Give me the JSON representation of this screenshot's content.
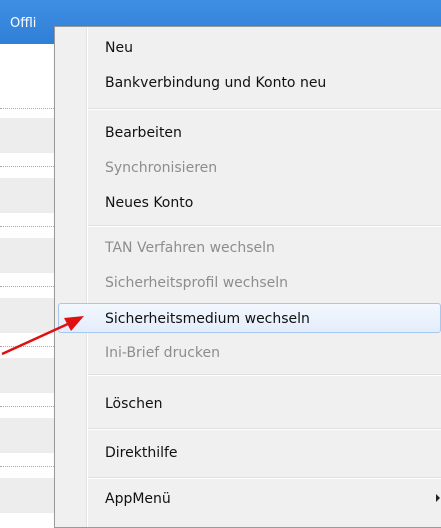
{
  "app": {
    "header_label": "Offli"
  },
  "context_menu": {
    "items": [
      {
        "label": "Neu",
        "enabled": true
      },
      {
        "label": "Bankverbindung und Konto neu",
        "enabled": true
      },
      {
        "label": "Bearbeiten",
        "enabled": true
      },
      {
        "label": "Synchronisieren",
        "enabled": false
      },
      {
        "label": "Neues Konto",
        "enabled": true
      },
      {
        "label": "TAN Verfahren wechseln",
        "enabled": false
      },
      {
        "label": "Sicherheitsprofil wechseln",
        "enabled": false
      },
      {
        "label": "Sicherheitsmedium wechseln",
        "enabled": true,
        "highlighted": true
      },
      {
        "label": "Ini-Brief drucken",
        "enabled": false
      },
      {
        "label": "Löschen",
        "enabled": true
      },
      {
        "label": "Direkthilfe",
        "enabled": true
      },
      {
        "label": "AppMenü",
        "enabled": true,
        "has_submenu": true
      }
    ]
  },
  "colors": {
    "header_blue": "#2f7fd8",
    "highlight_border": "#a8c7ec",
    "disabled_text": "#8d8d8d",
    "annotation_arrow": "#e01010"
  }
}
